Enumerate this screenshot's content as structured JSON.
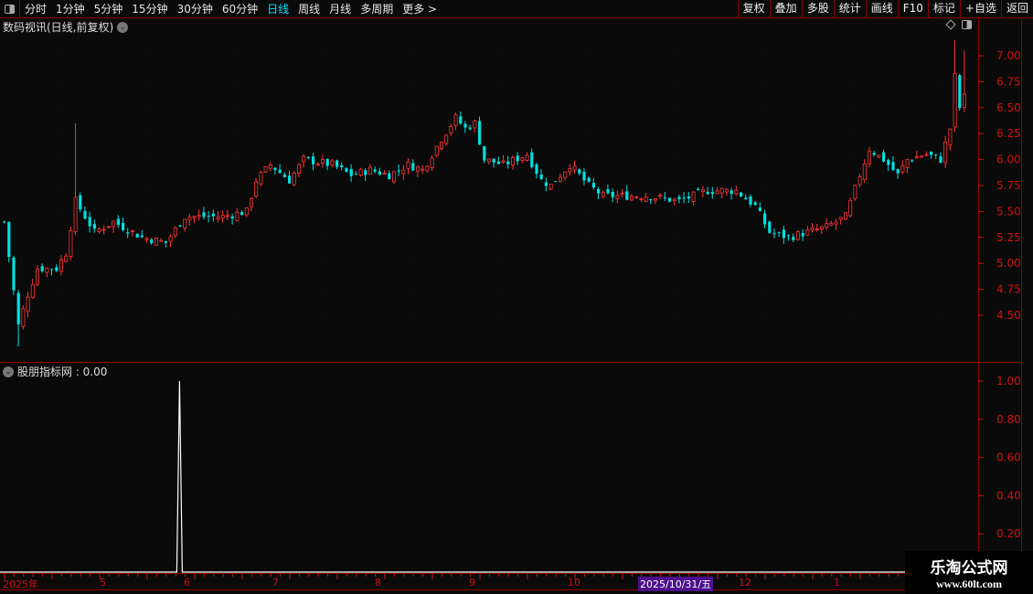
{
  "toolbar": {
    "periods": [
      "分时",
      "1分钟",
      "5分钟",
      "15分钟",
      "30分钟",
      "60分钟",
      "日线",
      "周线",
      "月线",
      "多周期",
      "更多 >"
    ],
    "active_period": "日线",
    "buttons": [
      "复权",
      "叠加",
      "多股",
      "统计",
      "画线",
      "F10",
      "标记",
      "+自选",
      "返回"
    ]
  },
  "main_panel": {
    "title": "数码视讯(日线,前复权)"
  },
  "indicator_panel": {
    "title": "股朋指标网 : 0.00"
  },
  "colors": {
    "up": "#ff3232",
    "down": "#00e0e0",
    "axis": "#d01010",
    "border": "#8b0000",
    "highlight": "#4b0f8a"
  },
  "chart_data": [
    {
      "type": "candlestick",
      "ylim": [
        4.2,
        7.2
      ],
      "yticks": [
        "7.00",
        "6.75",
        "6.50",
        "6.25",
        "6.00",
        "5.75",
        "5.50",
        "5.25",
        "5.00",
        "4.75",
        "4.50"
      ],
      "close_keypoints": [
        [
          0,
          5.4
        ],
        [
          3,
          4.4
        ],
        [
          5,
          4.7
        ],
        [
          7,
          4.95
        ],
        [
          11,
          4.95
        ],
        [
          13,
          5.1
        ],
        [
          15,
          5.6
        ],
        [
          19,
          5.3
        ],
        [
          23,
          5.4
        ],
        [
          29,
          5.25
        ],
        [
          34,
          5.2
        ],
        [
          38,
          5.45
        ],
        [
          46,
          5.45
        ],
        [
          51,
          5.5
        ],
        [
          53,
          5.8
        ],
        [
          56,
          5.95
        ],
        [
          60,
          5.8
        ],
        [
          63,
          6.0
        ],
        [
          69,
          5.95
        ],
        [
          73,
          5.85
        ],
        [
          77,
          5.9
        ],
        [
          81,
          5.85
        ],
        [
          85,
          5.95
        ],
        [
          88,
          5.9
        ],
        [
          92,
          6.2
        ],
        [
          95,
          6.4
        ],
        [
          97,
          6.3
        ],
        [
          99,
          6.35
        ],
        [
          101,
          6.0
        ],
        [
          105,
          5.95
        ],
        [
          110,
          6.05
        ],
        [
          113,
          5.8
        ],
        [
          115,
          5.75
        ],
        [
          119,
          5.95
        ],
        [
          123,
          5.75
        ],
        [
          126,
          5.65
        ],
        [
          135,
          5.65
        ],
        [
          142,
          5.6
        ],
        [
          148,
          5.7
        ],
        [
          154,
          5.7
        ],
        [
          158,
          5.55
        ],
        [
          161,
          5.3
        ],
        [
          165,
          5.25
        ],
        [
          169,
          5.3
        ],
        [
          173,
          5.35
        ],
        [
          177,
          5.45
        ],
        [
          180,
          5.85
        ],
        [
          182,
          6.1
        ],
        [
          185,
          6.0
        ],
        [
          188,
          5.85
        ],
        [
          190,
          6.0
        ],
        [
          194,
          6.05
        ],
        [
          197,
          6.0
        ],
        [
          199,
          6.3
        ],
        [
          200,
          6.8
        ],
        [
          201,
          6.5
        ],
        [
          202,
          6.6
        ]
      ]
    },
    {
      "type": "line",
      "ylim": [
        0,
        1.05
      ],
      "yticks": [
        "1.00",
        "0.80",
        "0.60",
        "0.40",
        "0.20"
      ],
      "spike_bar": 37,
      "spike_value": 1.0,
      "baseline": 0
    }
  ],
  "time_axis": {
    "labels": [
      "2025年",
      "5",
      "6",
      "7",
      "8",
      "9",
      "10",
      "2025/10/31/五",
      "12",
      "1"
    ],
    "highlighted": "2025/10/31/五"
  },
  "watermark": {
    "line1": "乐淘公式网",
    "line2": "www.60lt.com"
  }
}
